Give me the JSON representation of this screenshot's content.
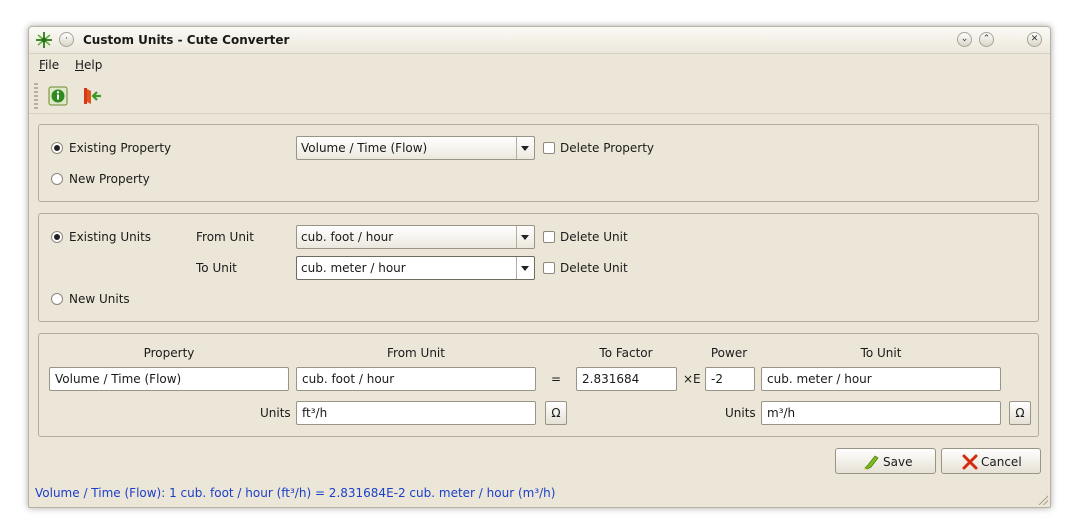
{
  "window": {
    "title": "Custom Units - Cute Converter"
  },
  "menu": {
    "file_label": "File",
    "help_label": "Help"
  },
  "property_group": {
    "existing_label": "Existing Property",
    "new_label": "New Property",
    "selected": "existing",
    "combo_value": "Volume / Time (Flow)",
    "delete_label": "Delete Property"
  },
  "units_group": {
    "existing_label": "Existing Units",
    "new_label": "New Units",
    "selected": "existing",
    "from_label": "From Unit",
    "from_value": "cub. foot / hour",
    "to_label": "To Unit",
    "to_value": "cub. meter / hour",
    "delete_label": "Delete Unit"
  },
  "editor": {
    "headers": {
      "property": "Property",
      "from_unit": "From Unit",
      "to_factor": "To Factor",
      "power": "Power",
      "to_unit": "To Unit"
    },
    "property_value": "Volume / Time (Flow)",
    "from_unit_value": "cub. foot / hour",
    "equals": "=",
    "factor_value": "2.831684",
    "times_e": "×E",
    "power_value": "-2",
    "to_unit_value": "cub. meter / hour",
    "units_label": "Units",
    "from_symbol": "ft³/h",
    "to_symbol": "m³/h",
    "omega": "Ω"
  },
  "buttons": {
    "save_label": "Save",
    "cancel_label": "Cancel"
  },
  "status": "Volume / Time (Flow): 1 cub. foot / hour (ft³/h) = 2.831684E-2 cub. meter / hour (m³/h)",
  "colors": {
    "window_bg": "#ece6d8",
    "status_text": "#1b3fc9",
    "cancel_icon": "#d42a10",
    "save_icon": "#7bbf1e"
  }
}
